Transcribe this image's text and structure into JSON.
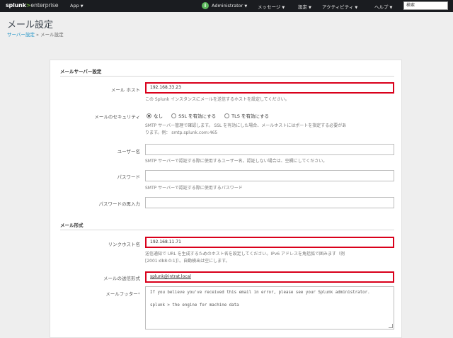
{
  "topbar": {
    "logo_main": "splunk",
    "logo_sep": ">",
    "logo_sub": "enterprise",
    "app_menu": "App",
    "user_menu": "Administrator",
    "messages_menu": "メッセージ",
    "settings_menu": "設定",
    "activity_menu": "アクティビティ",
    "help_menu": "ヘルプ",
    "search_placeholder": "検索",
    "info_icon": "i"
  },
  "header": {
    "title": "メール設定",
    "breadcrumb_link": "サーバー設定",
    "breadcrumb_sep": "»",
    "breadcrumb_current": "メール設定"
  },
  "mail_server": {
    "section_title": "メールサーバー設定",
    "host_label": "メール ホスト",
    "host_value": "192.168.33.23",
    "host_help": "この Splunk インスタンスにメールを送信するホストを設定してください。",
    "security_label": "メールのセキュリティ",
    "security_options": [
      "なし",
      "SSL を有効にする",
      "TLS を有効にする"
    ],
    "security_selected": 0,
    "security_help_1": "SMTP サーバー管理で確認します。 SSL を有効にした場合、メールホストにはポートを指定する必要があ",
    "security_help_2": "ります。例： smtp.splunk.com:465",
    "username_label": "ユーザー名",
    "username_value": "",
    "username_help": "SMTP サーバーで認証する際に使用するユーザー名。認証しない場合は、空欄にしてください。",
    "password_label": "パスワード",
    "password_value": "",
    "password_help": "SMTP サーバーで認証する際に使用するパスワード",
    "password_confirm_label": "パスワードの再入力",
    "password_confirm_value": ""
  },
  "mail_format": {
    "section_title": "メール形式",
    "link_host_label": "リンクホスト名",
    "link_host_value": "192.168.11.71",
    "link_host_help_1": "送信通知で URL を生成するためのホスト名を設定してください。IPv6 アドレスを角括弧で囲みます（例",
    "link_host_help_2": "[2001:db8:0:1]）。自動検出は空にします。",
    "sender_label": "メールの送信形式",
    "sender_value": "splunk@intrat.local",
    "footer_label": "メールフッター",
    "footer_required": "*",
    "footer_line_1": "If you believe you've received this email in error, please see your Splunk administrator.",
    "footer_line_2": "splunk > the engine for machine data"
  }
}
